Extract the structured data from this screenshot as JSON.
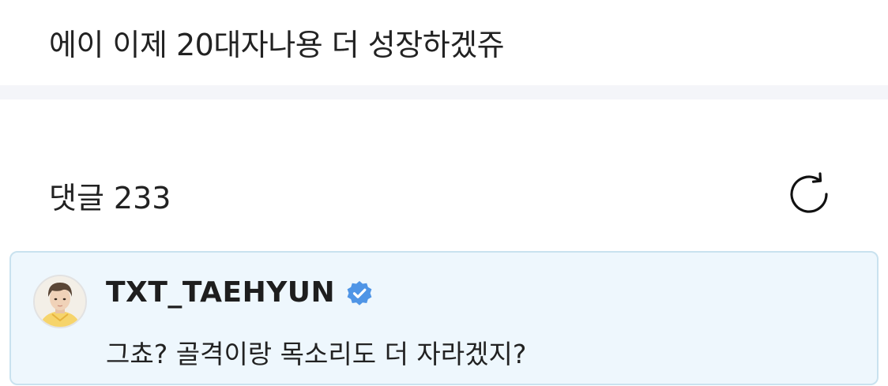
{
  "post": {
    "text": "에이 이제 20대자나용 더 성장하겠쥬"
  },
  "comments": {
    "label": "댓글",
    "count": "233",
    "refresh_icon": "refresh-icon"
  },
  "comment": {
    "author": "TXT_TAEHYUN",
    "verified_icon": "verified-badge-icon",
    "text": "그쵸? 골격이랑 목소리도 더 자라겠지?"
  },
  "colors": {
    "card_background": "#eef7fd",
    "card_border": "#c9e2ef",
    "verified_badge": "#4f95e6",
    "divider": "#f4f5f9"
  }
}
